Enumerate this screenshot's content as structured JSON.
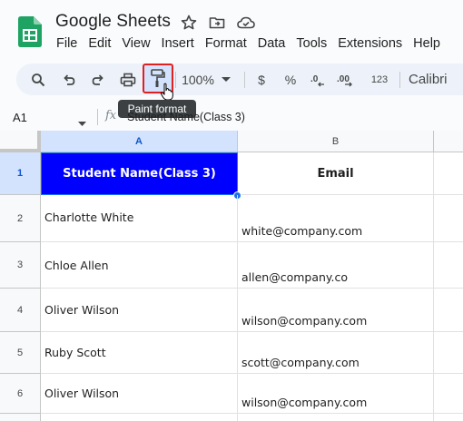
{
  "app": {
    "title": "Google Sheets",
    "icons": [
      "star-icon",
      "move-to-folder-icon",
      "cloud-status-icon"
    ]
  },
  "menu": [
    "File",
    "Edit",
    "View",
    "Insert",
    "Format",
    "Data",
    "Tools",
    "Extensions",
    "Help"
  ],
  "toolbar": {
    "zoom": "100%",
    "currency": "$",
    "percent": "%",
    "decrease_decimal": ".0",
    "increase_decimal": ".00",
    "number_format": "123",
    "font": "Calibri",
    "tooltip": "Paint format"
  },
  "formula_bar": {
    "cell_ref": "A1",
    "fx": "fx",
    "content": "Student Name(Class 3)"
  },
  "columns": [
    "A",
    "B"
  ],
  "rows": [
    {
      "num": "1",
      "name": "Student Name(Class 3)",
      "email": "Email"
    },
    {
      "num": "2",
      "name": "Charlotte White",
      "email": "white@company.com"
    },
    {
      "num": "3",
      "name": "Chloe Allen",
      "email": "allen@company.co"
    },
    {
      "num": "4",
      "name": "Oliver Wilson",
      "email": "wilson@company.com"
    },
    {
      "num": "5",
      "name": "Ruby Scott",
      "email": "scott@company.com"
    },
    {
      "num": "6",
      "name": "Oliver Wilson",
      "email": "wilson@company.com"
    }
  ],
  "colors": {
    "header_fill": "#0000ff",
    "header_text": "#ffffff",
    "accent": "#1a73e8",
    "highlight_border": "#e02020"
  }
}
